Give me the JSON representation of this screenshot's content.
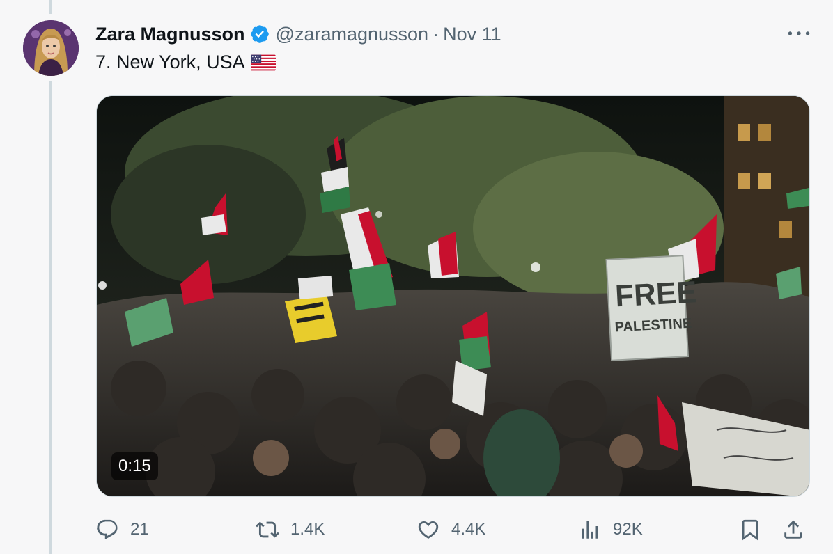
{
  "tweet": {
    "author_name": "Zara Magnusson",
    "handle": "@zaramagnusson",
    "separator": "·",
    "date": "Nov 11",
    "text": "7. New York, USA",
    "flag_icon": "us-flag-icon",
    "verified_icon": "verified-badge-icon",
    "verified_color": "#1d9bf0"
  },
  "media": {
    "type": "video",
    "duration": "0:15",
    "sign_text": "FREE PALESTINE"
  },
  "actions": {
    "reply_count": "21",
    "retweet_count": "1.4K",
    "like_count": "4.4K",
    "views_count": "92K"
  },
  "colors": {
    "background": "#f7f7f8",
    "text_primary": "#0f1419",
    "text_secondary": "#536471",
    "thread_line": "#cfd9de"
  }
}
